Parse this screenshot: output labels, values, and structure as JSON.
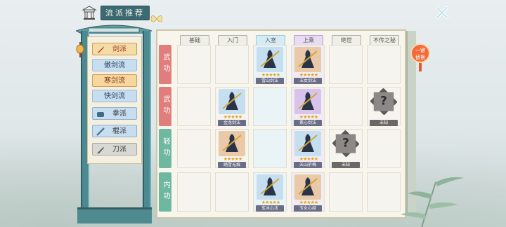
{
  "header": {
    "title": "流派推荐"
  },
  "menu": {
    "items": [
      {
        "label": "剑派",
        "kind": "cat",
        "active": true
      },
      {
        "label": "傲剑流",
        "kind": "sub"
      },
      {
        "label": "寒剑流",
        "kind": "sub",
        "active": true
      },
      {
        "label": "快剑流",
        "kind": "sub"
      },
      {
        "label": "拳派",
        "kind": "cat"
      },
      {
        "label": "棍派",
        "kind": "cat"
      },
      {
        "label": "刀派",
        "kind": "gray"
      }
    ]
  },
  "columns": [
    "基础",
    "入门",
    "入室",
    "上乘",
    "绝世",
    "不传之秘"
  ],
  "rows": [
    "武功",
    "武功",
    "轻功",
    "内功"
  ],
  "skills": [
    {
      "row": 0,
      "col": 2,
      "name": "雪山剑法",
      "stars": "★★★★★"
    },
    {
      "row": 0,
      "col": 3,
      "name": "玉女剑法",
      "stars": "★★★★★"
    },
    {
      "row": 1,
      "col": 1,
      "name": "金龙剑法",
      "stars": "★★★★★"
    },
    {
      "row": 1,
      "col": 3,
      "name": "素心剑法",
      "stars": "★★★★★"
    },
    {
      "row": 1,
      "col": 5,
      "name": "未知",
      "stars": "",
      "unknown": true
    },
    {
      "row": 2,
      "col": 1,
      "name": "踏雪无痕",
      "stars": "★★★★★"
    },
    {
      "row": 2,
      "col": 3,
      "name": "天山折梅",
      "stars": "★★★★★"
    },
    {
      "row": 2,
      "col": 4,
      "name": "未知",
      "stars": "",
      "unknown": true
    },
    {
      "row": 3,
      "col": 2,
      "name": "玄冰心法",
      "stars": "★★★★★"
    },
    {
      "row": 3,
      "col": 3,
      "name": "玉女心经",
      "stars": "★★★★★"
    }
  ],
  "badge": {
    "line1": "一键",
    "line2": "替换"
  },
  "colors": {
    "accent": "#3c6a73",
    "active": "#f4dca6",
    "badge": "#f06a3a"
  }
}
